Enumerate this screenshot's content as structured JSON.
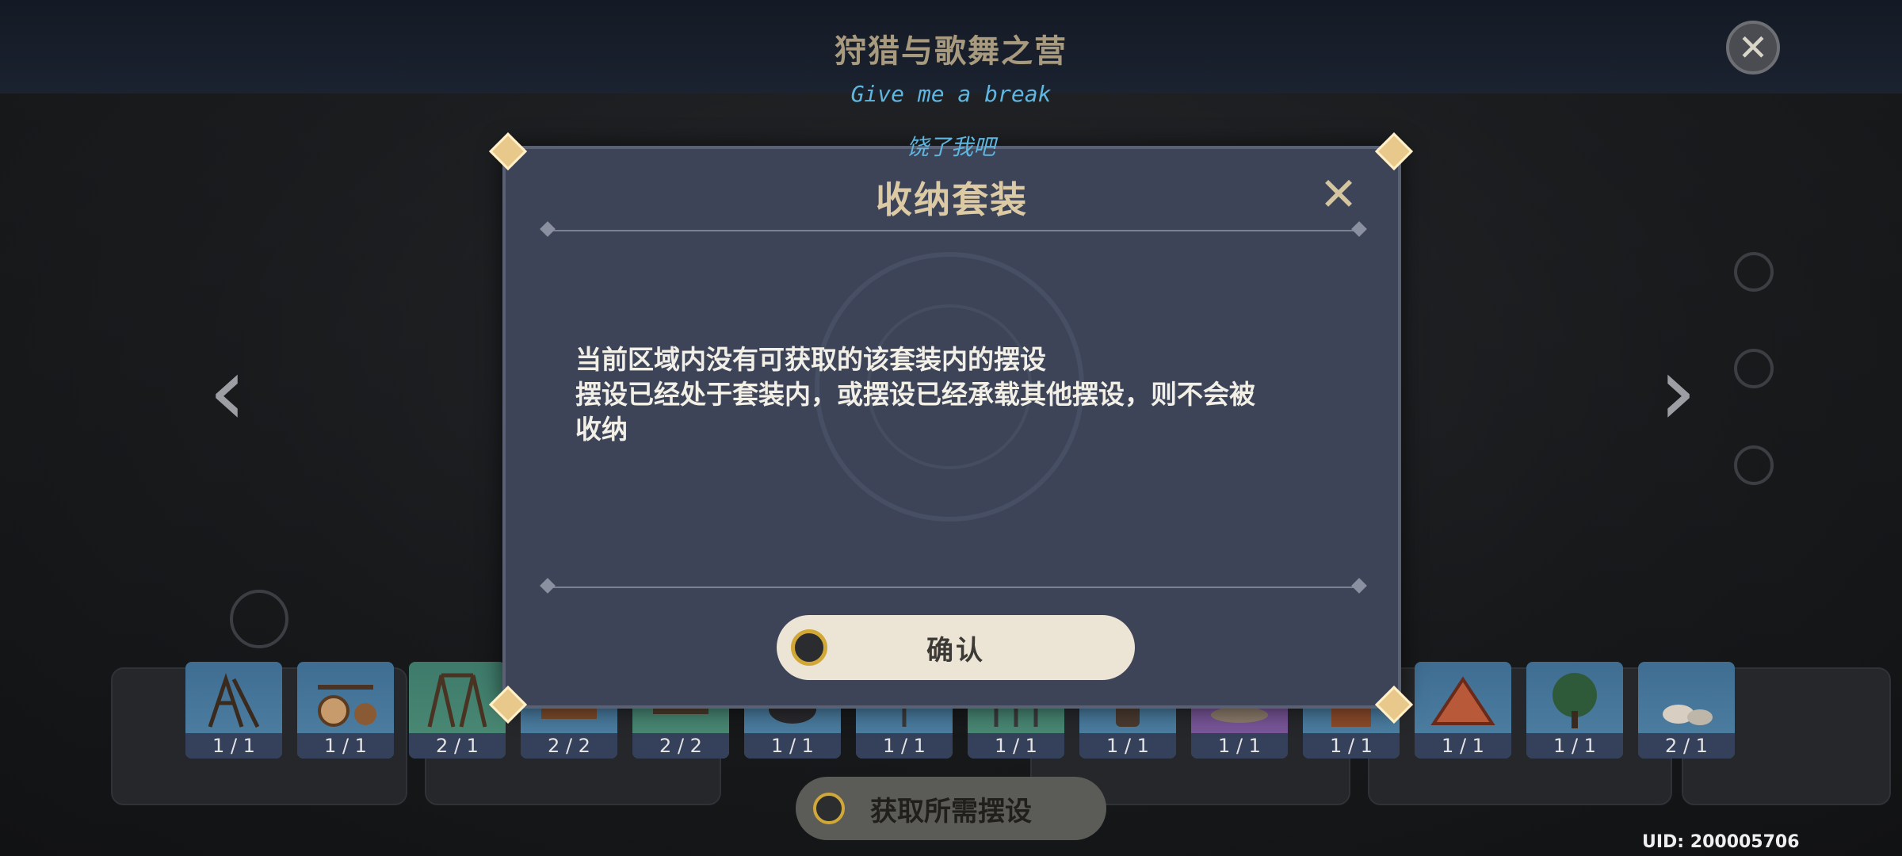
{
  "header": {
    "title": "狩猎与歌舞之营"
  },
  "subtitles": {
    "english": "Give me a break",
    "chinese": "饶了我吧"
  },
  "dialog": {
    "title": "收纳套装",
    "message_lines": [
      "当前区域内没有可获取的该套装内的摆设",
      "摆设已经处于套装内，或摆设已经承载其他摆设，则不会被",
      "收纳"
    ],
    "confirm_label": "确认"
  },
  "items": [
    {
      "count": "1 / 1",
      "icon": "siege-frame-icon"
    },
    {
      "count": "1 / 1",
      "icon": "wheel-cart-icon"
    },
    {
      "count": "2 / 1",
      "icon": "swing-icon"
    },
    {
      "count": "2 / 2",
      "icon": "cart-icon"
    },
    {
      "count": "2 / 2",
      "icon": "bench-icon"
    },
    {
      "count": "1 / 1",
      "icon": "cauldron-icon"
    },
    {
      "count": "1 / 1",
      "icon": "lamp-icon"
    },
    {
      "count": "1 / 1",
      "icon": "fence-icon"
    },
    {
      "count": "1 / 1",
      "icon": "barrel-icon"
    },
    {
      "count": "1 / 1",
      "icon": "rug-icon"
    },
    {
      "count": "1 / 1",
      "icon": "crate-icon"
    },
    {
      "count": "1 / 1",
      "icon": "tent-icon"
    },
    {
      "count": "1 / 1",
      "icon": "tree-icon"
    },
    {
      "count": "2 / 1",
      "icon": "rocks-icon"
    }
  ],
  "actions": {
    "get_required_label": "获取所需摆设"
  },
  "footer": {
    "uid": "UID: 200005706"
  }
}
